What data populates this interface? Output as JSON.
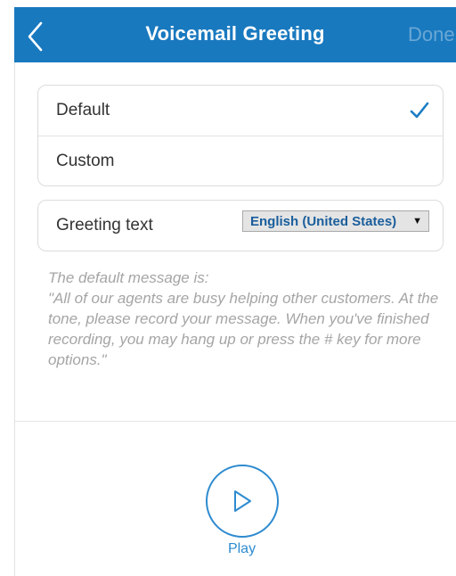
{
  "colors": {
    "header_bg": "#1979bf",
    "accent": "#2e8bd0",
    "muted_text": "#a5a5a5"
  },
  "header": {
    "back_icon": "chevron-left-icon",
    "title": "Voicemail Greeting",
    "done_label": "Done"
  },
  "greeting_options": {
    "items": [
      {
        "label": "Default",
        "selected": true
      },
      {
        "label": "Custom",
        "selected": false
      }
    ],
    "selected_icon": "checkmark-icon"
  },
  "greeting_text": {
    "label": "Greeting text",
    "language_selected": "English (United States)",
    "dropdown_icon": "dropdown-arrow-icon"
  },
  "default_message": {
    "intro": "The default message is:",
    "body": "\"All of our agents are busy helping other customers. At the tone, please record your message. When you've finished recording, you may hang up or press the # key for more options.\""
  },
  "player": {
    "play_icon": "play-icon",
    "play_label": "Play"
  }
}
